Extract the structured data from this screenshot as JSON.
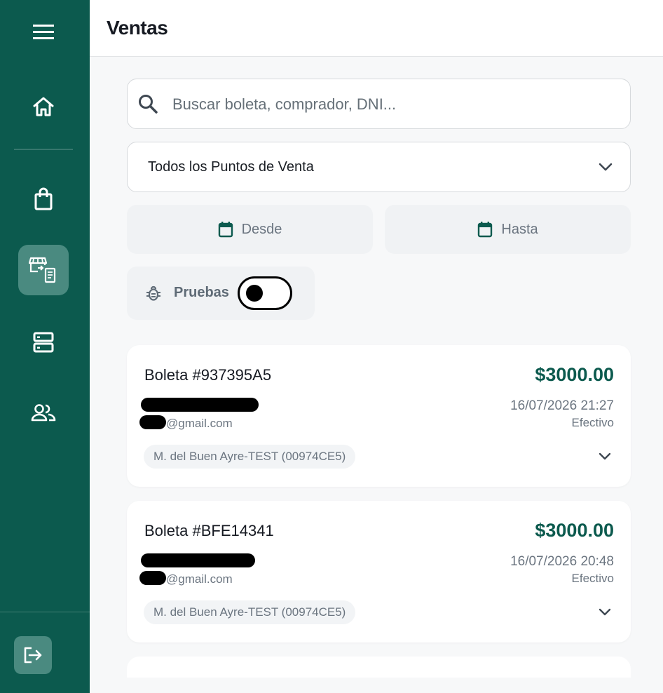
{
  "app": {
    "title": "Ventas",
    "theme": {
      "sidebar": "#0c5a4e",
      "accent": "#0c5a4e"
    }
  },
  "sidebar": {
    "items": [
      {
        "name": "menu",
        "icon": "hamburger-menu-icon"
      },
      {
        "name": "home",
        "icon": "home-icon"
      },
      {
        "name": "products",
        "icon": "shopping-bag-icon"
      },
      {
        "name": "sales",
        "icon": "store-receipt-icon",
        "active": true
      },
      {
        "name": "servers",
        "icon": "server-icon"
      },
      {
        "name": "users",
        "icon": "users-icon"
      },
      {
        "name": "logout",
        "icon": "logout-icon"
      }
    ]
  },
  "filters": {
    "search_placeholder": "Buscar boleta, comprador, DNI...",
    "point_of_sale": "Todos los Puntos de Venta",
    "date_from": "Desde",
    "date_to": "Hasta",
    "test_toggle_label": "Pruebas",
    "test_toggle_on": false
  },
  "sales": [
    {
      "title": "Boleta #937395A5",
      "amount": "$3000.00",
      "email_suffix": "@gmail.com",
      "datetime": "16/07/2026 21:27",
      "payment": "Efectivo",
      "point_of_sale": "M. del Buen Ayre-TEST (00974CE5)"
    },
    {
      "title": "Boleta #BFE14341",
      "amount": "$3000.00",
      "email_suffix": "@gmail.com",
      "datetime": "16/07/2026 20:48",
      "payment": "Efectivo",
      "point_of_sale": "M. del Buen Ayre-TEST (00974CE5)"
    }
  ]
}
